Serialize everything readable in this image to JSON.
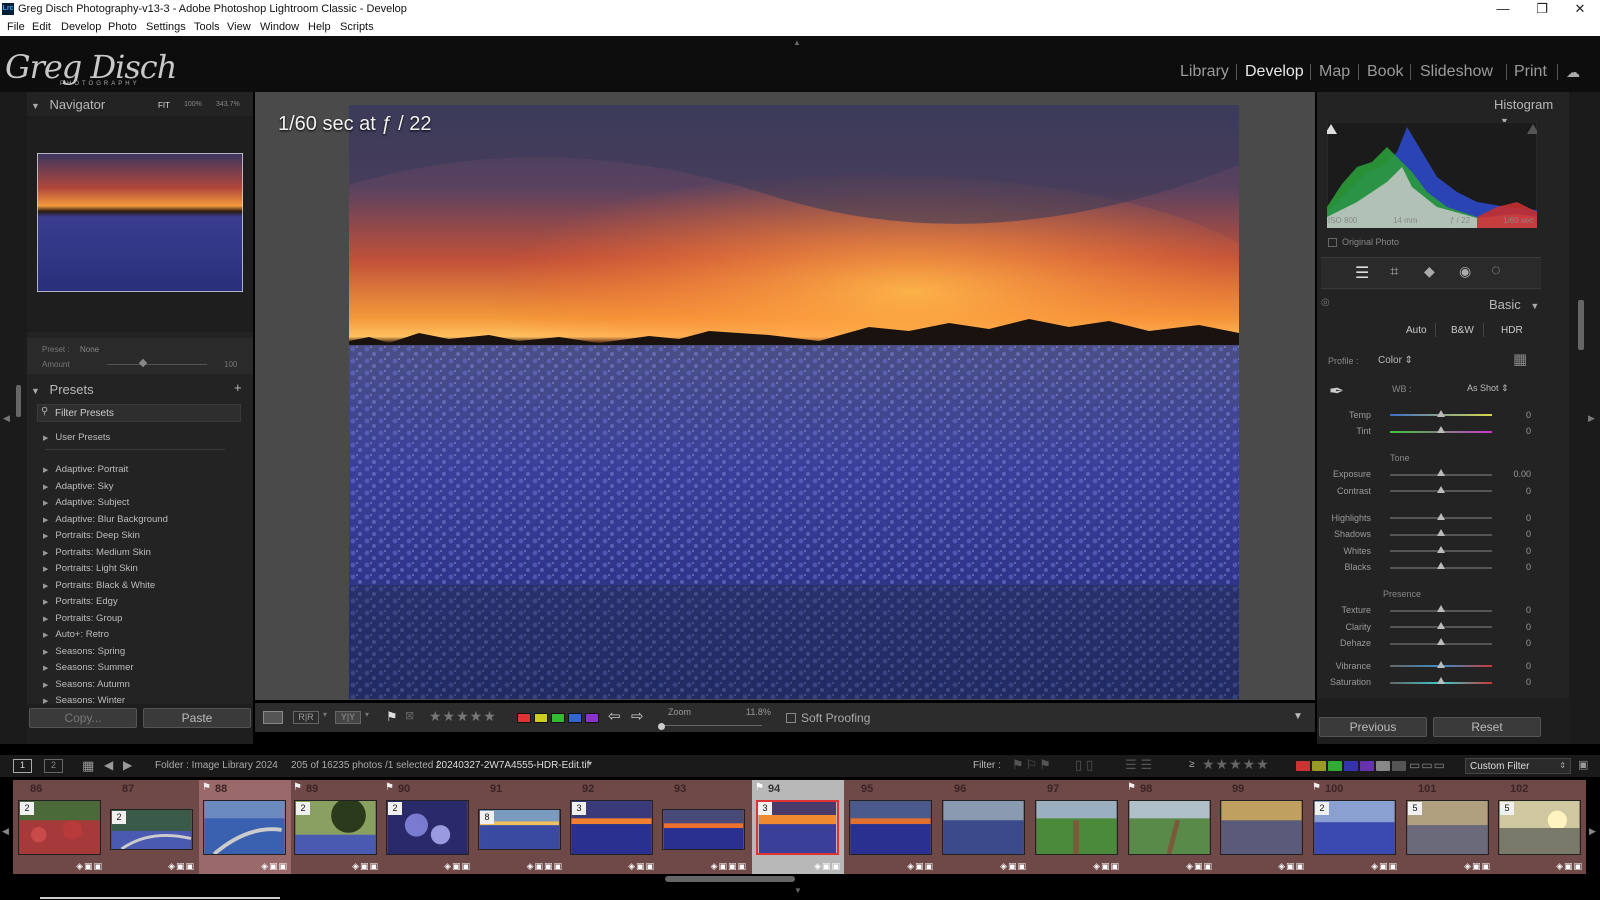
{
  "window": {
    "app_icon": "Lrc",
    "title": "Greg Disch Photography-v13-3 - Adobe Photoshop Lightroom Classic - Develop",
    "minimize_icon": "minimize-icon",
    "maximize_icon": "restore-icon",
    "close_icon": "close-icon"
  },
  "menu": [
    "File",
    "Edit",
    "Develop",
    "Photo",
    "Settings",
    "Tools",
    "View",
    "Window",
    "Help",
    "Scripts"
  ],
  "identity": {
    "brand": "Greg Disch",
    "brand_sub": "PHOTOGRAPHY"
  },
  "modules": [
    "Library",
    "Develop",
    "Map",
    "Book",
    "Slideshow",
    "Print"
  ],
  "active_module": "Develop",
  "navigator": {
    "title": "Navigator",
    "fit": "FIT",
    "z100": "100%",
    "z3": "343.7%"
  },
  "preset_amount": {
    "preset_label": "Preset :",
    "preset_value": "None",
    "amount_label": "Amount",
    "amount_value": "100"
  },
  "presets": {
    "title": "Presets",
    "filter": "Filter Presets",
    "groups": [
      "User Presets",
      "Adaptive: Portrait",
      "Adaptive: Sky",
      "Adaptive: Subject",
      "Adaptive: Blur Background",
      "Portraits: Deep Skin",
      "Portraits: Medium Skin",
      "Portraits: Light Skin",
      "Portraits: Black & White",
      "Portraits: Edgy",
      "Portraits: Group",
      "Auto+: Retro",
      "Seasons: Spring",
      "Seasons: Summer",
      "Seasons: Autumn",
      "Seasons: Winter"
    ]
  },
  "left_buttons": {
    "copy": "Copy...",
    "paste": "Paste"
  },
  "photo_info": "1/60 sec at ƒ / 22",
  "toolbar": {
    "zoom_label": "Zoom",
    "zoom_value": "11.8%",
    "soft_proofing": "Soft Proofing",
    "view_rr": "R|R",
    "view_yy": "Y|Y"
  },
  "histogram": {
    "title": "Histogram",
    "iso": "ISO 800",
    "focal": "14 mm",
    "aperture": "ƒ / 22",
    "shutter": "1/60 sec",
    "original": "Original Photo"
  },
  "basic": {
    "title": "Basic",
    "auto": "Auto",
    "bw": "B&W",
    "hdr": "HDR",
    "profile_label": "Profile :",
    "profile_value": "Color",
    "wb_label": "WB :",
    "wb_value": "As Shot",
    "tone_label": "Tone",
    "presence_label": "Presence",
    "sliders": [
      {
        "label": "Temp",
        "value": "0"
      },
      {
        "label": "Tint",
        "value": "0"
      },
      {
        "label": "Exposure",
        "value": "0.00"
      },
      {
        "label": "Contrast",
        "value": "0"
      },
      {
        "label": "Highlights",
        "value": "0"
      },
      {
        "label": "Shadows",
        "value": "0"
      },
      {
        "label": "Whites",
        "value": "0"
      },
      {
        "label": "Blacks",
        "value": "0"
      },
      {
        "label": "Texture",
        "value": "0"
      },
      {
        "label": "Clarity",
        "value": "0"
      },
      {
        "label": "Dehaze",
        "value": "0"
      },
      {
        "label": "Vibrance",
        "value": "0"
      },
      {
        "label": "Saturation",
        "value": "0"
      }
    ]
  },
  "right_buttons": {
    "previous": "Previous",
    "reset": "Reset"
  },
  "filmbar": {
    "screen1": "1",
    "screen2": "2",
    "source": "Folder : Image Library 2024",
    "count": "205 of 16235 photos /1 selected /",
    "file": "20240327-2W7A4555-HDR-Edit.tif",
    "filter_label": "Filter :",
    "ge": "≥",
    "custom_filter": "Custom Filter"
  },
  "filmstrip": [
    {
      "num": "86",
      "badge": "2"
    },
    {
      "num": "87",
      "badge": "2"
    },
    {
      "num": "88",
      "badge": ""
    },
    {
      "num": "89",
      "badge": "2"
    },
    {
      "num": "90",
      "badge": "2"
    },
    {
      "num": "91",
      "badge": "8"
    },
    {
      "num": "92",
      "badge": "3"
    },
    {
      "num": "93",
      "badge": ""
    },
    {
      "num": "94",
      "badge": "3"
    },
    {
      "num": "95",
      "badge": ""
    },
    {
      "num": "96",
      "badge": ""
    },
    {
      "num": "97",
      "badge": ""
    },
    {
      "num": "98",
      "badge": ""
    },
    {
      "num": "99",
      "badge": ""
    },
    {
      "num": "100",
      "badge": "2"
    },
    {
      "num": "101",
      "badge": "5"
    },
    {
      "num": "102",
      "badge": "5"
    }
  ],
  "colors": {
    "filmstrip_bg": "#6f4848",
    "selected_cell": "#a87070",
    "label_red": "#d33",
    "label_yellow": "#cc2",
    "label_green": "#3b3",
    "label_blue": "#36c",
    "label_purple": "#83c"
  }
}
